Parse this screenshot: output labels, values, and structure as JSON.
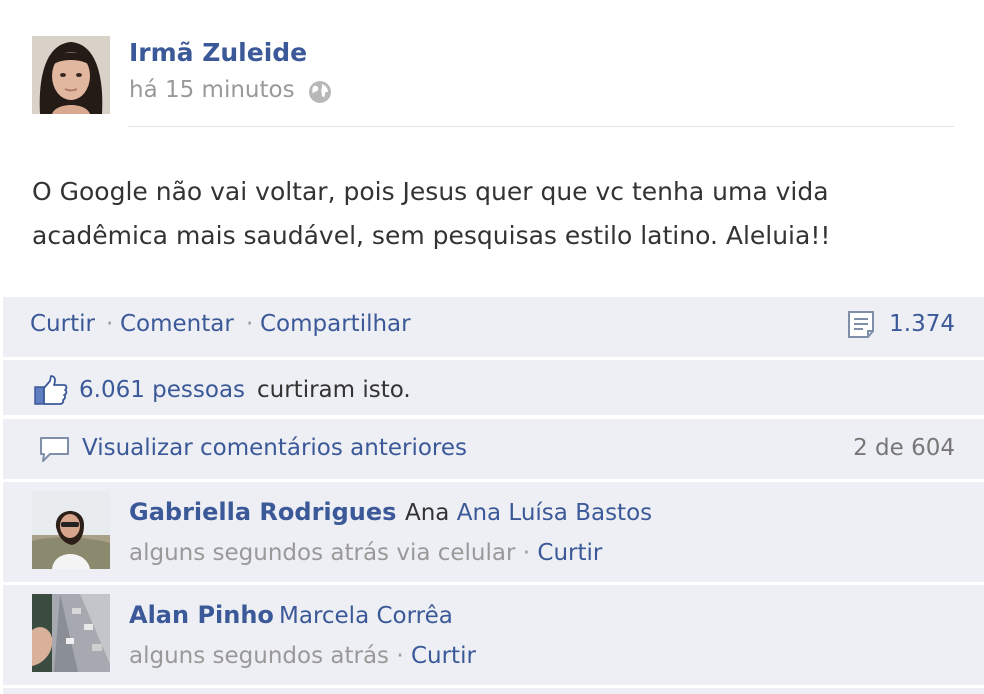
{
  "post": {
    "author": "Irmã Zuleide",
    "time": "há 15 minutos",
    "text": "O Google não vai voltar, pois Jesus quer que vc tenha uma vida acadêmica mais saudável, sem pesquisas estilo latino. Aleluia!!",
    "icons": {
      "audience": "globe-icon",
      "shares": "share-icon",
      "likes": "thumbs-up-icon",
      "comments": "speech-bubble-icon"
    }
  },
  "actions": {
    "like": "Curtir",
    "comment": "Comentar",
    "share": "Compartilhar",
    "separator": "·",
    "share_count": "1.374"
  },
  "likes": {
    "count": "6.061 pessoas",
    "suffix": "curtiram isto."
  },
  "comments_header": {
    "link": "Visualizar comentários anteriores",
    "count": "2 de 604"
  },
  "comments": [
    {
      "name": "Gabriella Rodrigues",
      "text": "Ana",
      "tag": "Ana Luísa Bastos",
      "meta": "alguns segundos atrás via celular",
      "like": "Curtir"
    },
    {
      "name": "Alan Pinho",
      "text": "",
      "tag": "Marcela Corrêa",
      "meta": "alguns segundos atrás",
      "like": "Curtir"
    }
  ],
  "colors": {
    "link": "#3b5998",
    "text": "#333333",
    "muted": "#999999",
    "panel": "#edeff4"
  }
}
